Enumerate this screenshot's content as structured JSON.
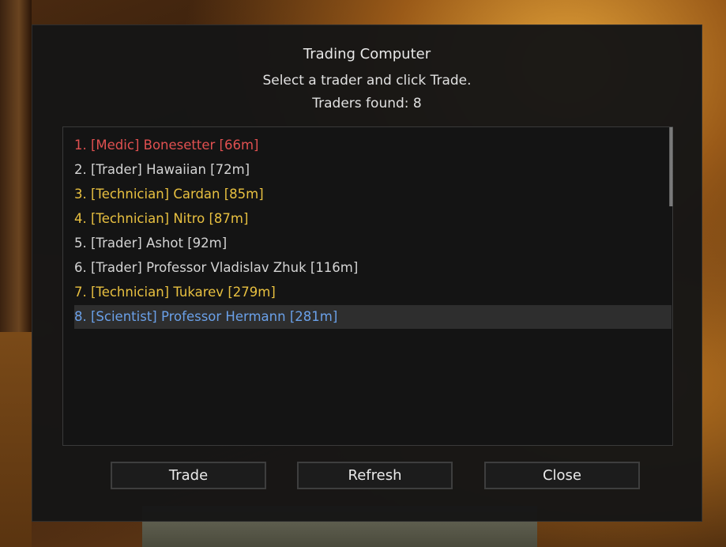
{
  "dialog": {
    "title": "Trading Computer",
    "subtitle": "Select a trader and click Trade.",
    "traders_found": "Traders found: 8"
  },
  "traders": [
    {
      "label": "1. [Medic] Bonesetter [66m]",
      "color": "#e05050"
    },
    {
      "label": "2. [Trader] Hawaiian [72m]",
      "color": "#d4d4d4"
    },
    {
      "label": "3. [Technician] Cardan [85m]",
      "color": "#e8c040"
    },
    {
      "label": "4. [Technician] Nitro [87m]",
      "color": "#e8c040"
    },
    {
      "label": "5. [Trader] Ashot [92m]",
      "color": "#d4d4d4"
    },
    {
      "label": "6. [Trader] Professor Vladislav Zhuk [116m]",
      "color": "#d4d4d4"
    },
    {
      "label": "7. [Technician] Tukarev [279m]",
      "color": "#e8c040"
    },
    {
      "label": "8. [Scientist] Professor Hermann [281m]",
      "color": "#6aa0e8",
      "selected": true
    }
  ],
  "buttons": {
    "trade": "Trade",
    "refresh": "Refresh",
    "close": "Close"
  }
}
